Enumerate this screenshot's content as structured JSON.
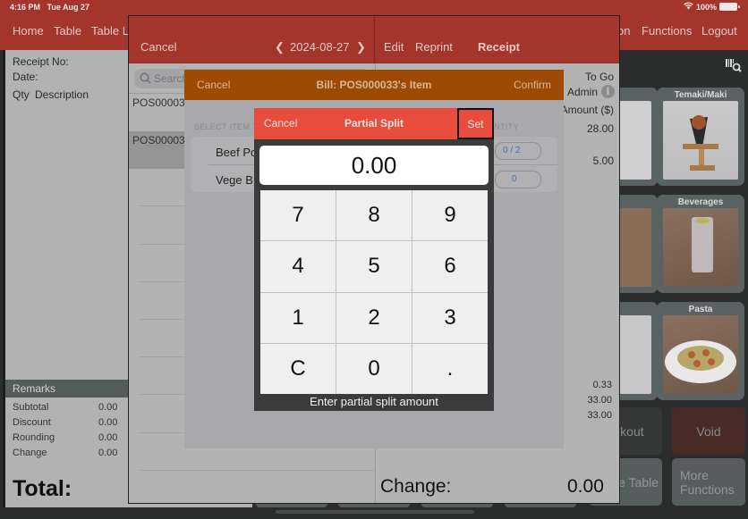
{
  "status_bar": {
    "time": "4:16 PM",
    "date": "Tue Aug 27",
    "battery": "100%"
  },
  "top_nav": {
    "left_items": [
      "Home",
      "Table",
      "Table La"
    ],
    "right_items": [
      "on",
      "Functions",
      "Logout"
    ]
  },
  "receipt_panel": {
    "receipt_no_label": "Receipt No:",
    "date_label": "Date:",
    "qty_label": "Qty",
    "description_label": "Description",
    "remarks_label": "Remarks",
    "summary": [
      {
        "label": "Subtotal",
        "value": "0.00"
      },
      {
        "label": "Discount",
        "value": "0.00"
      },
      {
        "label": "Rounding",
        "value": "0.00"
      },
      {
        "label": "Change",
        "value": "0.00"
      }
    ],
    "total_label": "Total:"
  },
  "categories": [
    {
      "title": "Temaki/Maki"
    },
    {
      "title": "Beverages"
    },
    {
      "title": "Pasta"
    }
  ],
  "actions": {
    "checkout_label": "eckout",
    "void_label": "Void",
    "table_label": "e Table",
    "more_functions_label": "More Functions"
  },
  "bill_sheet": {
    "cancel_label": "Cancel",
    "date": "2024-08-27",
    "edit_label": "Edit",
    "reprint_label": "Reprint",
    "receipt_label": "Receipt",
    "search_placeholder": "Search",
    "bills": [
      "POS00003",
      "POS00003"
    ],
    "detail": {
      "order_type": "To Go",
      "staff": "Admin",
      "amount_header": "Amount ($)",
      "amounts": [
        "28.00",
        "5.00"
      ],
      "totals": [
        "0.33",
        "33.00",
        "33.00"
      ],
      "change_label": "Change:",
      "change_value": "0.00"
    }
  },
  "item_sheet": {
    "cancel_label": "Cancel",
    "title": "Bill: POS000033's Item",
    "confirm_label": "Confirm",
    "select_label": "SELECT ITEM T",
    "quantity_label": "ANTITY",
    "items": [
      {
        "name": "Beef Po",
        "qty": "0 / 2"
      },
      {
        "name": "Vege B",
        "qty": "0"
      }
    ]
  },
  "keypad": {
    "cancel_label": "Cancel",
    "title": "Partial Split",
    "set_label": "Set",
    "display_value": "0.00",
    "keys": [
      "7",
      "8",
      "9",
      "4",
      "5",
      "6",
      "1",
      "2",
      "3",
      "C",
      "0",
      "."
    ],
    "hint": "Enter partial split amount"
  }
}
